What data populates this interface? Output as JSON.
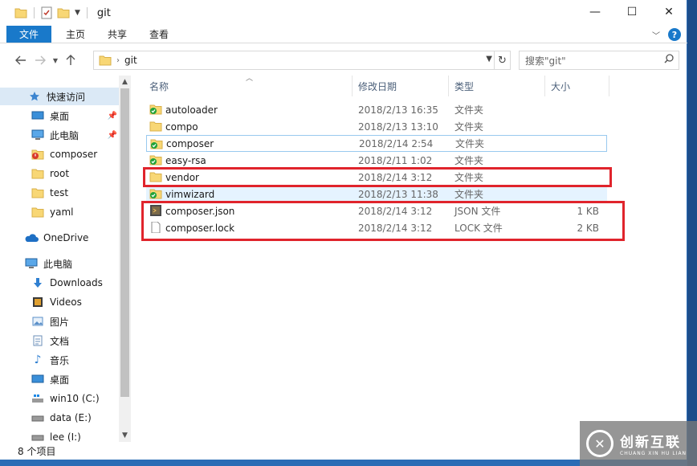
{
  "window": {
    "title": "git",
    "minimize": "—",
    "maximize": "☐",
    "close": "✕"
  },
  "ribbon": {
    "tabs": [
      "文件",
      "主页",
      "共享",
      "查看"
    ]
  },
  "address": {
    "path": "git",
    "search_placeholder": "搜索\"git\""
  },
  "nav": {
    "quick_access": "快速访问",
    "items": [
      "桌面",
      "此电脑",
      "composer",
      "root",
      "test",
      "yaml"
    ],
    "onedrive": "OneDrive",
    "this_pc": "此电脑",
    "pc_items": [
      "Downloads",
      "Videos",
      "图片",
      "文档",
      "音乐",
      "桌面",
      "win10 (C:)",
      "data (E:)",
      "lee (I:)"
    ]
  },
  "columns": {
    "name": "名称",
    "modified": "修改日期",
    "type": "类型",
    "size": "大小"
  },
  "files": [
    {
      "name": "autoloader",
      "date": "2018/2/13 16:35",
      "type": "文件夹",
      "size": "",
      "icon": "folder-synced-icon"
    },
    {
      "name": "compo",
      "date": "2018/2/13 13:10",
      "type": "文件夹",
      "size": "",
      "icon": "folder-icon"
    },
    {
      "name": "composer",
      "date": "2018/2/14 2:54",
      "type": "文件夹",
      "size": "",
      "icon": "folder-synced-icon"
    },
    {
      "name": "easy-rsa",
      "date": "2018/2/11 1:02",
      "type": "文件夹",
      "size": "",
      "icon": "folder-synced-icon"
    },
    {
      "name": "vendor",
      "date": "2018/2/14 3:12",
      "type": "文件夹",
      "size": "",
      "icon": "folder-icon"
    },
    {
      "name": "vimwizard",
      "date": "2018/2/13 11:38",
      "type": "文件夹",
      "size": "",
      "icon": "folder-synced-icon"
    },
    {
      "name": "composer.json",
      "date": "2018/2/14 3:12",
      "type": "JSON 文件",
      "size": "1 KB",
      "icon": "json-file-icon"
    },
    {
      "name": "composer.lock",
      "date": "2018/2/14 3:12",
      "type": "LOCK 文件",
      "size": "2 KB",
      "icon": "file-icon"
    }
  ],
  "status": {
    "count": "8 个项目"
  },
  "watermark": {
    "brand": "创新互联",
    "sub": "CHUANG XIN HU LIAN"
  }
}
